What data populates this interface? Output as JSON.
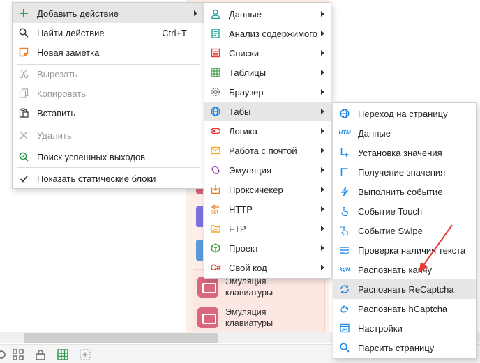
{
  "background": {
    "blocks": [
      {
        "label": "Эмуляция\nклавиатуры"
      },
      {
        "label": "Эмуляция\nклавиатуры"
      }
    ]
  },
  "menu_main": {
    "items": [
      {
        "label": "Добавить действие",
        "icon": "plus-icon",
        "shortcut": "",
        "submenu": true,
        "highlighted": true,
        "disabled": false
      },
      {
        "label": "Найти действие",
        "icon": "search-icon",
        "shortcut": "Ctrl+T",
        "submenu": false,
        "highlighted": false,
        "disabled": false
      },
      {
        "label": "Новая заметка",
        "icon": "note-icon",
        "shortcut": "",
        "submenu": false,
        "highlighted": false,
        "disabled": false
      },
      {
        "label": "Вырезать",
        "icon": "scissors-icon",
        "shortcut": "",
        "submenu": false,
        "highlighted": false,
        "disabled": true
      },
      {
        "label": "Копировать",
        "icon": "copy-icon",
        "shortcut": "",
        "submenu": false,
        "highlighted": false,
        "disabled": true
      },
      {
        "label": "Вставить",
        "icon": "paste-icon",
        "shortcut": "",
        "submenu": false,
        "highlighted": false,
        "disabled": false
      },
      {
        "label": "Удалить",
        "icon": "delete-icon",
        "shortcut": "",
        "submenu": false,
        "highlighted": false,
        "disabled": true
      },
      {
        "label": "Поиск успешных выходов",
        "icon": "search-success-icon",
        "shortcut": "",
        "submenu": false,
        "highlighted": false,
        "disabled": false
      },
      {
        "label": "Показать статические блоки",
        "icon": "checkmark-icon",
        "shortcut": "",
        "submenu": false,
        "highlighted": false,
        "disabled": false
      }
    ]
  },
  "menu_actions": {
    "items": [
      {
        "label": "Данные",
        "icon": "user-icon",
        "color": "#26a69a"
      },
      {
        "label": "Анализ содержимого",
        "icon": "document-icon",
        "color": "#26a69a"
      },
      {
        "label": "Списки",
        "icon": "list-icon",
        "color": "#e53935"
      },
      {
        "label": "Таблицы",
        "icon": "table-icon",
        "color": "#43a047"
      },
      {
        "label": "Браузер",
        "icon": "gear-icon",
        "color": "#555555"
      },
      {
        "label": "Табы",
        "icon": "globe-icon",
        "color": "#1e88e5"
      },
      {
        "label": "Логика",
        "icon": "toggle-icon",
        "color": "#e53935"
      },
      {
        "label": "Работа с почтой",
        "icon": "envelope-icon",
        "color": "#f6a623"
      },
      {
        "label": "Эмуляция",
        "icon": "mouse-icon",
        "color": "#8e44ad"
      },
      {
        "label": "Проксичекер",
        "icon": "proxy-icon",
        "color": "#e67e22"
      },
      {
        "label": "HTTP",
        "icon": "http-get-icon",
        "color": "#e67e22"
      },
      {
        "label": "FTP",
        "icon": "ftp-folder-icon",
        "color": "#f6a623"
      },
      {
        "label": "Проект",
        "icon": "cube-icon",
        "color": "#43a047"
      },
      {
        "label": "Свой код",
        "icon": "csharp-icon",
        "color": "#e53935"
      }
    ],
    "highlighted_index": 5
  },
  "menu_tabs": {
    "items": [
      {
        "label": "Переход на страницу",
        "icon": "globe-icon"
      },
      {
        "label": "Данные",
        "icon": "html-icon"
      },
      {
        "label": "Установка значения",
        "icon": "arrow-set-icon"
      },
      {
        "label": "Получение значения",
        "icon": "arrow-get-icon"
      },
      {
        "label": "Выполнить событие",
        "icon": "lightning-icon"
      },
      {
        "label": "Событие Touch",
        "icon": "touch-hand-icon"
      },
      {
        "label": "Событие Swipe",
        "icon": "swipe-hand-icon"
      },
      {
        "label": "Проверка наличия текста",
        "icon": "text-check-icon"
      },
      {
        "label": "Распознать капчу",
        "icon": "captcha-icon"
      },
      {
        "label": "Распознать ReCaptcha",
        "icon": "recaptcha-icon"
      },
      {
        "label": "Распознать hCaptcha",
        "icon": "hcaptcha-icon"
      },
      {
        "label": "Настройки",
        "icon": "settings-window-icon"
      },
      {
        "label": "Парсить страницу",
        "icon": "parse-search-icon"
      }
    ],
    "highlighted_index": 9,
    "accent": "#1e88e5"
  },
  "annotation": {
    "arrow_color": "#e53935"
  }
}
